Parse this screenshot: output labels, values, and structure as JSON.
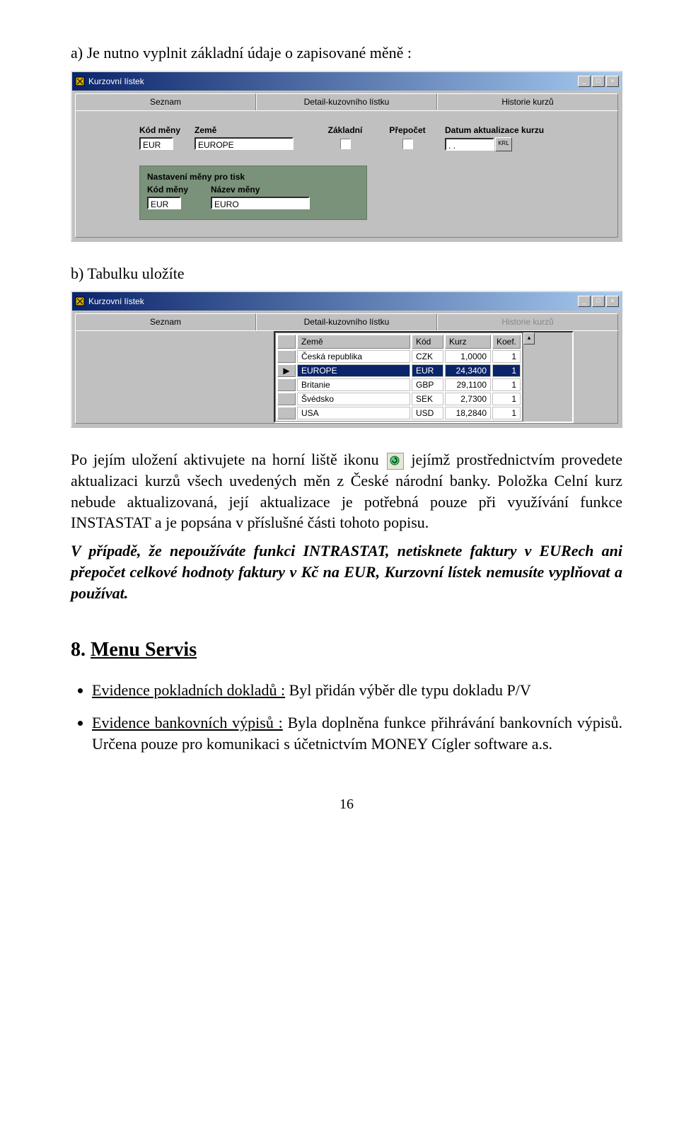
{
  "doc": {
    "a_line": "a) Je nutno vyplnit základní údaje o zapisované měně :",
    "b_line": "b) Tabulku uložíte",
    "p1a": "Po jejím uložení aktivujete na horní liště ikonu ",
    "p1b": " jejímž prostřednictvím provedete aktualizaci kurzů všech uvedených měn z České národní banky. Položka Celní kurz nebude aktualizovaná, její aktualizace je potřebná pouze při využívání funkce INSTASTAT a je popsána v příslušné části tohoto popisu.",
    "p2": "V případě, že nepoužíváte funkci INTRASTAT, netisknete faktury v EURech ani přepočet celkové hodnoty faktury v Kč na EUR, Kurzovní lístek nemusíte vyplňovat a používat.",
    "section_num": "8. ",
    "section_title": "Menu Servis",
    "bullet1_lead": "Evidence pokladních dokladů :",
    "bullet1_rest": " Byl přidán výběr dle typu dokladu P/V",
    "bullet2_lead": "Evidence bankovních výpisů :",
    "bullet2_rest": " Byla doplněna funkce přihrávání bankovních výpisů. Určena pouze pro komunikaci s účetnictvím MONEY Cígler software a.s.",
    "page_num": "16"
  },
  "win_title": "Kurzovní lístek",
  "tabs": {
    "seznam": "Seznam",
    "detail": "Detail-kuzovního lístku",
    "historie": "Historie kurzů"
  },
  "form1": {
    "kod_label": "Kód měny",
    "kod_val": "EUR",
    "zeme_label": "Země",
    "zeme_val": "EUROPE",
    "zakladni_label": "Základní",
    "prepocet_label": "Přepočet",
    "datum_label": "Datum aktualizace kurzu",
    "datum_val": " .   .",
    "date_btn": "KRL",
    "group_title": "Nastavení měny pro tisk",
    "g_kod_label": "Kód měny",
    "g_kod_val": "EUR",
    "g_nazev_label": "Název měny",
    "g_nazev_val": "EURO"
  },
  "grid": {
    "headers": {
      "zeme": "Země",
      "kod": "Kód",
      "kurz": "Kurz",
      "koef": "Koef."
    },
    "rows": [
      {
        "zeme": "Česká republika",
        "kod": "CZK",
        "kurz": "1,0000",
        "koef": "1"
      },
      {
        "zeme": "EUROPE",
        "kod": "EUR",
        "kurz": "24,3400",
        "koef": "1"
      },
      {
        "zeme": "Britanie",
        "kod": "GBP",
        "kurz": "29,1100",
        "koef": "1"
      },
      {
        "zeme": "Švédsko",
        "kod": "SEK",
        "kurz": "2,7300",
        "koef": "1"
      },
      {
        "zeme": "USA",
        "kod": "USD",
        "kurz": "18,2840",
        "koef": "1"
      }
    ],
    "selected_index": 1
  }
}
